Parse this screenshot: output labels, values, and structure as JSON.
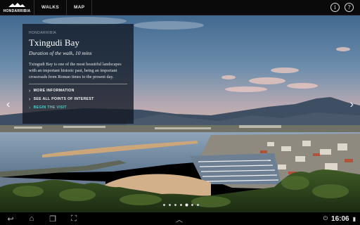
{
  "app": {
    "logo_text": "HONDARRIBIA",
    "nav": [
      "WALKS",
      "MAP"
    ],
    "icons": [
      "info-icon",
      "help-icon"
    ],
    "info_glyph": "i",
    "help_glyph": "?"
  },
  "panel": {
    "kicker": "HONDARRIBIA",
    "title": "Txingudi Bay",
    "subtitle": "Duration of the walk, 10 mins",
    "description": "Txingudi Bay is one of the most beautiful landscapes with an important historic past, being an important crossroads from Roman times to the present day.",
    "links": [
      "MORE INFORMATION",
      "SEE ALL POINTS OF INTEREST",
      "BEGIN THE VISIT"
    ],
    "accent_color": "#5fc6c4"
  },
  "carousel": {
    "total_dots": 7,
    "active_index": 4
  },
  "system_bar": {
    "time": "16:06"
  }
}
